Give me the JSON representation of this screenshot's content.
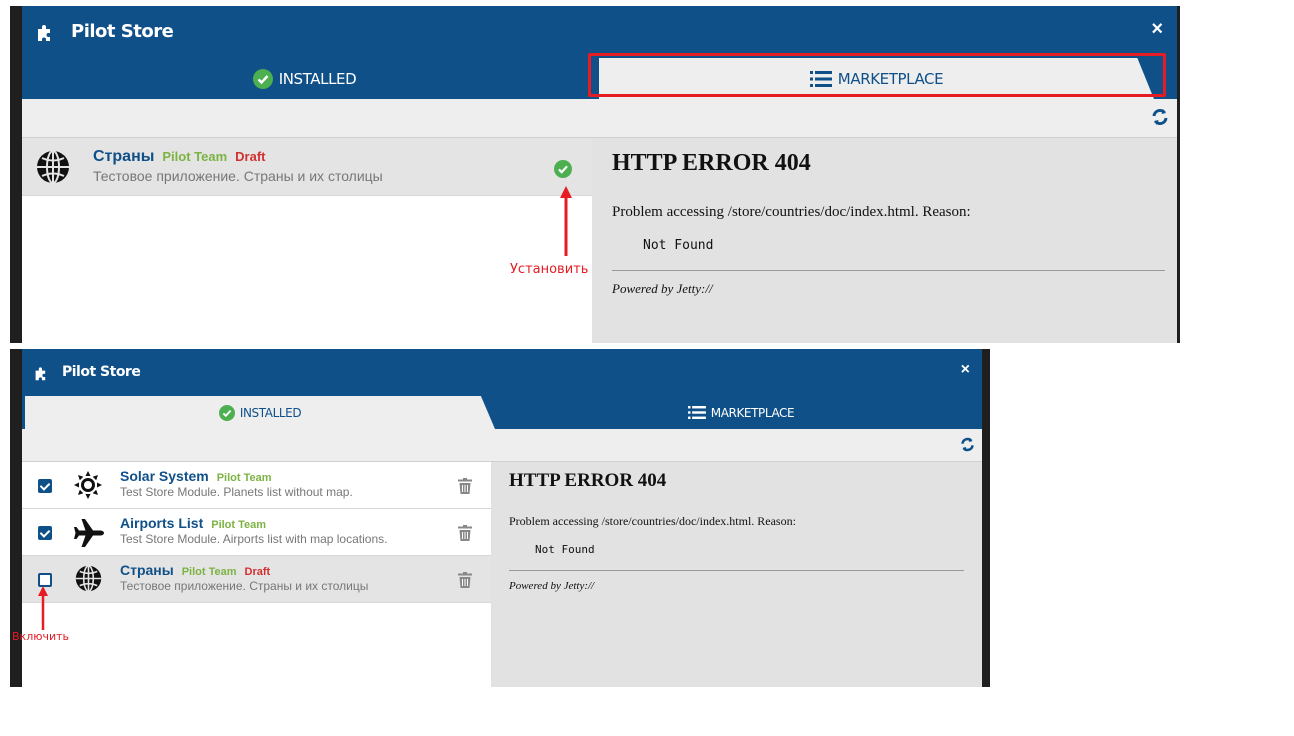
{
  "top": {
    "title": "Pilot Store",
    "close": "×",
    "tabs": {
      "installed": "INSTALLED",
      "marketplace": "MARKETPLACE"
    },
    "item": {
      "name": "Страны",
      "author": "Pilot Team",
      "status": "Draft",
      "description": "Тестовое приложение. Страны и их столицы"
    },
    "doc": {
      "heading": "HTTP ERROR 404",
      "problem": "Problem accessing /store/countries/doc/index.html. Reason:",
      "reason": "Not Found",
      "powered": "Powered by Jetty://"
    },
    "annotation": "Установить"
  },
  "bottom": {
    "title": "Pilot Store",
    "close": "×",
    "tabs": {
      "installed": "INSTALLED",
      "marketplace": "MARKETPLACE"
    },
    "items": [
      {
        "name": "Solar System",
        "author": "Pilot Team",
        "status": "",
        "description": "Test Store Module. Planets list without map.",
        "enabled": true
      },
      {
        "name": "Airports List",
        "author": "Pilot Team",
        "status": "",
        "description": "Test Store Module. Airports list with map locations.",
        "enabled": true
      },
      {
        "name": "Страны",
        "author": "Pilot Team",
        "status": "Draft",
        "description": "Тестовое приложение. Страны и их столицы",
        "enabled": false
      }
    ],
    "doc": {
      "heading": "HTTP ERROR 404",
      "problem": "Problem accessing /store/countries/doc/index.html. Reason:",
      "reason": "Not Found",
      "powered": "Powered by Jetty://"
    },
    "annotation": "Включить"
  },
  "colors": {
    "titlebar": "#0f5089",
    "author": "#7cb342",
    "draft": "#d32f2f",
    "annotation": "#e51c23",
    "installed_check": "#4caf50"
  },
  "icons": {
    "app": "puzzle-icon",
    "installed_tab": "check-circle-icon",
    "marketplace_tab": "list-icon",
    "refresh": "refresh-icon",
    "trash": "trash-icon",
    "installed_status": "check-circle-icon"
  }
}
